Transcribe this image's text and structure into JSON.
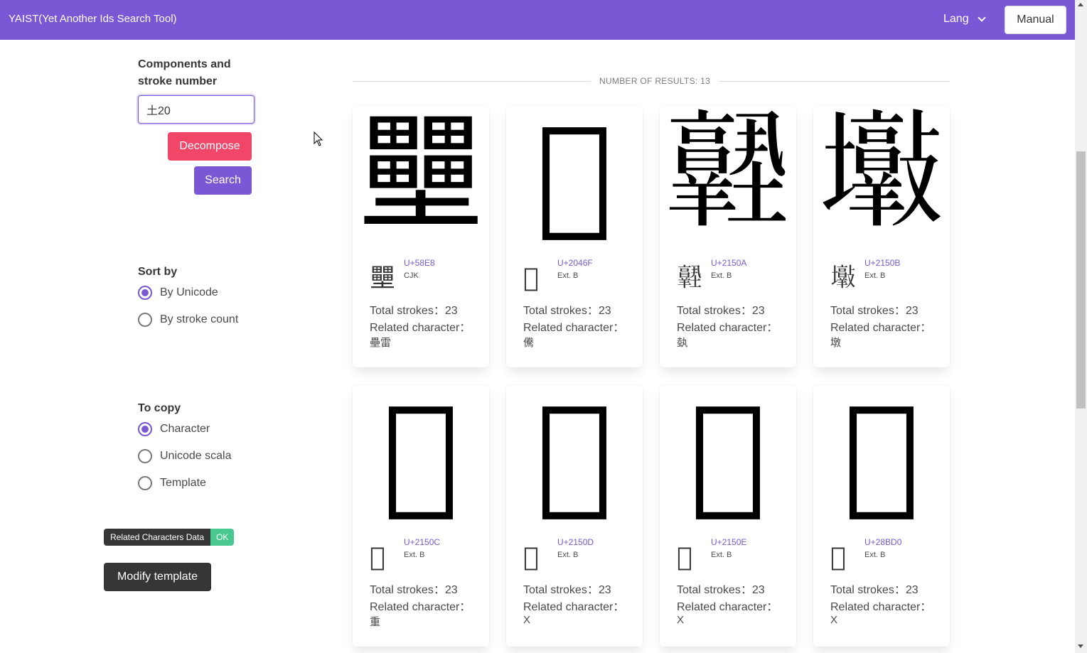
{
  "header": {
    "title": "YAIST(Yet Another Ids Search Tool)",
    "lang_label": "Lang",
    "manual_label": "Manual"
  },
  "search": {
    "label": "Components and stroke number",
    "label_line1": "Components and",
    "label_line2": "stroke number",
    "value": "土20",
    "decompose_label": "Decompose",
    "search_label": "Search"
  },
  "sort": {
    "label": "Sort by",
    "options": [
      "By Unicode",
      "By stroke count"
    ],
    "selected": "By Unicode"
  },
  "copy": {
    "label": "To copy",
    "options": [
      "Character",
      "Unicode scala",
      "Template"
    ],
    "selected": "Character"
  },
  "related_data": {
    "label": "Related Characters Data",
    "status": "OK"
  },
  "modify_template_label": "Modify template",
  "results": {
    "count_label": "NUMBER OF RESULTS: 13",
    "strokes_prefix": "Total strokes：",
    "related_prefix": "Related character：",
    "items": [
      {
        "char": "壨",
        "code": "U+58E8",
        "block": "CJK",
        "strokes": "Total strokes：23",
        "related_label": "Related character：",
        "related": "壘雷"
      },
      {
        "char": "𠑯",
        "code": "U+2046F",
        "block": "Ext. B",
        "strokes": "Total strokes：23",
        "related_label": "Related character：",
        "related": "儯"
      },
      {
        "char": "𡔊",
        "code": "U+2150A",
        "block": "Ext. B",
        "strokes": "Total strokes：23",
        "related_label": "Related character：",
        "related": "埶"
      },
      {
        "char": "𡔋",
        "code": "U+2150B",
        "block": "Ext. B",
        "strokes": "Total strokes：23",
        "related_label": "Related character：",
        "related": "墩"
      },
      {
        "char": "𡔌",
        "code": "U+2150C",
        "block": "Ext. B",
        "strokes": "Total strokes：23",
        "related_label": "Related character：",
        "related": "重"
      },
      {
        "char": "𡔍",
        "code": "U+2150D",
        "block": "Ext. B",
        "strokes": "Total strokes：23",
        "related_label": "Related character：",
        "related": "X"
      },
      {
        "char": "𡔎",
        "code": "U+2150E",
        "block": "Ext. B",
        "strokes": "Total strokes：23",
        "related_label": "Related character：",
        "related": "X"
      },
      {
        "char": "𨯐",
        "code": "U+28BD0",
        "block": "Ext. B",
        "strokes": "Total strokes：23",
        "related_label": "Related character：",
        "related": "X"
      }
    ]
  },
  "colors": {
    "primary": "#7957d5",
    "danger": "#f14668",
    "dark": "#363636",
    "success": "#48c78e"
  }
}
